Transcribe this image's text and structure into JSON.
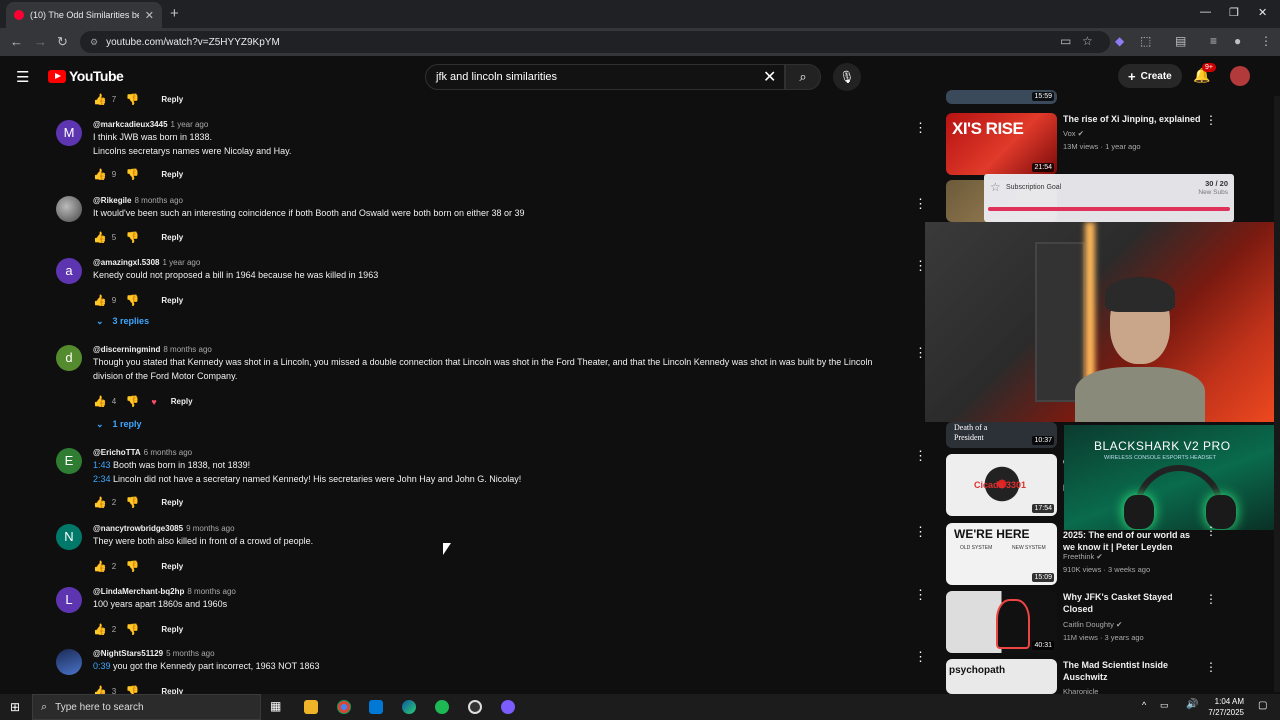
{
  "browser": {
    "tab_title": "(10) The Odd Similarities betwe",
    "url": "youtube.com/watch?v=Z5HYYZ9KpYM"
  },
  "header": {
    "logo_text": "YouTube",
    "search_value": "jfk and lincoln similarities",
    "create_label": "Create",
    "notif_badge": "9+"
  },
  "top_partial": {
    "reply": "Reply"
  },
  "comments": [
    {
      "avatar": "M",
      "color": "#5e35b1",
      "user": "@markcadieux3445",
      "time": "1 year ago",
      "lines": [
        "I think JWB was born in 1838.",
        "Lincolns secretarys names were Nicolay and Hay."
      ],
      "likes": "9",
      "reply": "Reply"
    },
    {
      "avatar": "",
      "color": "#555",
      "user": "@Rikegile",
      "time": "8 months ago",
      "lines": [
        "It would've been such an interesting coincidence if both Booth and Oswald were both born on either 38 or 39"
      ],
      "likes": "5",
      "reply": "Reply"
    },
    {
      "avatar": "a",
      "color": "#5e35b1",
      "user": "@amazingxl.5308",
      "time": "1 year ago",
      "lines": [
        "Kenedy could not proposed a bill in 1964 because he was killed in 1963"
      ],
      "likes": "9",
      "reply": "Reply",
      "replies": "3 replies"
    },
    {
      "avatar": "d",
      "color": "#558b2f",
      "user": "@discerningmind",
      "time": "8 months ago",
      "lines": [
        "Though you stated that Kennedy was shot in a Lincoln, you missed a double connection that Lincoln was shot in the Ford Theater, and that the Lincoln Kennedy was shot in was built by the Lincoln",
        "division of the Ford Motor Company."
      ],
      "likes": "4",
      "reply": "Reply",
      "replies": "1 reply"
    },
    {
      "avatar": "E",
      "color": "#2e7d32",
      "user": "@ErichoTTA",
      "time": "6 months ago",
      "ts1": "1:43",
      "line1": " Booth was born in 1838, not 1839!",
      "ts2": "2:34",
      "line2": " Lincoln did not have a secretary named Kennedy!  His secretaries were John Hay and John G. Nicolay!",
      "likes": "2",
      "reply": "Reply"
    },
    {
      "avatar": "N",
      "color": "#00796b",
      "user": "@nancytrowbridge3085",
      "time": "9 months ago",
      "lines": [
        "They were both also killed in front of a crowd of people."
      ],
      "likes": "2",
      "reply": "Reply"
    },
    {
      "avatar": "L",
      "color": "#5e35b1",
      "user": "@LindaMerchant-bq2hp",
      "time": "8 months ago",
      "lines": [
        "100 years apart 1860s and 1960s"
      ],
      "likes": "2",
      "reply": "Reply"
    },
    {
      "avatar": "",
      "color": "#2a4d8f",
      "user": "@NightStars51129",
      "time": "5 months ago",
      "ts1": "0:39",
      "line1": " you got the Kennedy part incorrect, 1963 NOT 1863",
      "likes": "3",
      "reply": "Reply"
    }
  ],
  "sidebar": {
    "top_duration": "15:59",
    "videos": [
      {
        "thumb_text": "XI'S RISE",
        "duration": "21:54",
        "title": "The rise of Xi Jinping, explained",
        "channel": "Vox",
        "meta": "13M views · 1 year ago"
      },
      {
        "thumb_text": "Death of a President",
        "duration": "10:37"
      },
      {
        "thumb_text": "Cicada 3301",
        "duration": "17:54",
        "title_fragment": "C",
        "title_fragment2": "L"
      },
      {
        "thumb_text": "WE'RE HERE",
        "thumb_sub1": "OLD SYSTEM",
        "thumb_sub2": "NEW SYSTEM",
        "duration": "15:09",
        "title": "2025: The end of our world as we know it | Peter Leyden",
        "channel": "Freethink",
        "meta": "910K views · 3 weeks ago"
      },
      {
        "duration": "40:31",
        "title": "Why JFK's Casket Stayed Closed",
        "channel": "Caitlin Doughty",
        "meta": "11M views · 3 years ago"
      },
      {
        "thumb_text": "psychopath",
        "title": "The Mad Scientist Inside Auschwitz",
        "channel": "Kharonicle"
      }
    ]
  },
  "overlays": {
    "goal_title": "Subscription Goal",
    "goal_count": "30 / 20",
    "goal_sub": "New Subs",
    "goal_progress": 1.0,
    "ad_brand": "BLACKSHARK V2 PRO",
    "ad_sub": "WIRELESS CONSOLE ESPORTS HEADSET"
  },
  "taskbar": {
    "search_placeholder": "Type here to search",
    "time": "1:04 AM",
    "date": "7/27/2025"
  }
}
